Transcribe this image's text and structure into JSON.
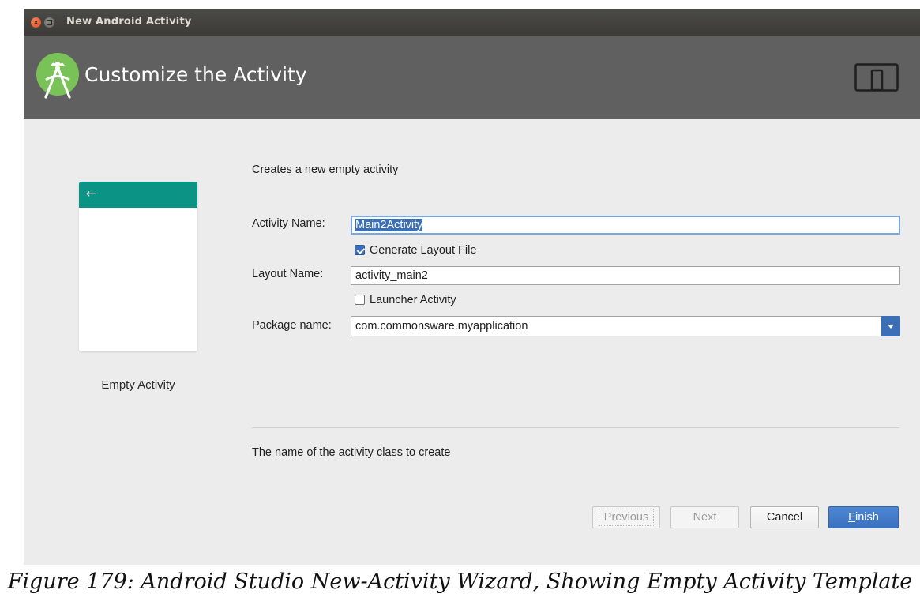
{
  "window": {
    "title": "New Android Activity"
  },
  "banner": {
    "title": "Customize the Activity",
    "logo_icon": "android-studio-logo",
    "device_icon": "tablet-phone-icon"
  },
  "template": {
    "name": "Empty Activity",
    "back_icon": "←",
    "toolbar_color": "#0b9386"
  },
  "form": {
    "description": "Creates a new empty activity",
    "activity_name": {
      "label": "Activity Name:",
      "value": "Main2Activity"
    },
    "generate_layout": {
      "label": "Generate Layout File",
      "checked": true
    },
    "layout_name": {
      "label": "Layout Name:",
      "value": "activity_main2"
    },
    "launcher_activity": {
      "label": "Launcher Activity",
      "checked": false
    },
    "package_name": {
      "label": "Package name:",
      "value": "com.commonsware.myapplication"
    }
  },
  "help_text": "The name of the activity class to create",
  "buttons": {
    "previous": "Previous",
    "next": "Next",
    "cancel": "Cancel",
    "finish_mnemonic": "F",
    "finish_rest": "inish"
  },
  "colors": {
    "accent": "#3c6fb6",
    "banner": "#606060"
  },
  "caption": "Figure 179: Android Studio New-Activity Wizard, Showing Empty Activity Template"
}
